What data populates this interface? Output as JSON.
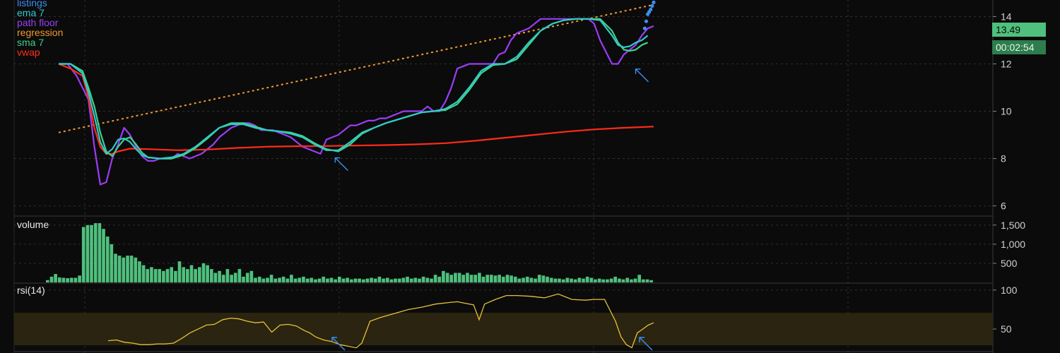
{
  "legend": [
    {
      "label": "listings",
      "color": "#3d8ef0"
    },
    {
      "label": "ema 7",
      "color": "#33c9c9"
    },
    {
      "label": "path floor",
      "color": "#9b3df5"
    },
    {
      "label": "regression",
      "color": "#f29a2e"
    },
    {
      "label": "sma 7",
      "color": "#3fd18a"
    },
    {
      "label": "vwap",
      "color": "#ff2b1a"
    }
  ],
  "price_badge": "13.49",
  "timer_badge": "00:02:54",
  "panes": {
    "volume_label": "volume",
    "rsi_label": "rsi(14)"
  },
  "colors": {
    "background": "#0b0b0b",
    "grid": "#2e2e2e",
    "axis_text": "#d0d0d0",
    "volume": "#4fc07d",
    "rsi": "#e5c23a",
    "rsi_band": "#2a2410",
    "arrow": "#3d8ef0"
  },
  "chart_data": [
    {
      "type": "line",
      "pane": "price",
      "yticks": [
        6,
        8,
        10,
        12,
        14
      ],
      "ylim": [
        5.6,
        14.7
      ],
      "xlim": [
        0,
        200
      ],
      "series": [
        {
          "name": "path floor",
          "color": "#9b3df5",
          "x": [
            0,
            3,
            6,
            8,
            10,
            12,
            14,
            16,
            18,
            20,
            22,
            24,
            26,
            28,
            30,
            32,
            34,
            36,
            38,
            40,
            44,
            48,
            52,
            54,
            56,
            58,
            60,
            62,
            64,
            66,
            68,
            70,
            72,
            74,
            76,
            78,
            80,
            82,
            84,
            86,
            88,
            90,
            92,
            94,
            96,
            98,
            100,
            102,
            104,
            106,
            108,
            110,
            112,
            114,
            116,
            118,
            120,
            122,
            124,
            126,
            128,
            130,
            132,
            134,
            136,
            138,
            140,
            142,
            144,
            146,
            148,
            150,
            152,
            154,
            156,
            158,
            160,
            162,
            164,
            166,
            168,
            170,
            172,
            174,
            176,
            178,
            180,
            182,
            184,
            186,
            188,
            190,
            192,
            194,
            196,
            198,
            200
          ],
          "y": [
            12,
            12,
            11.5,
            11,
            10.5,
            8.5,
            6.9,
            7,
            8,
            8.6,
            9.3,
            9,
            8.5,
            8.1,
            7.9,
            7.9,
            8,
            8,
            8,
            8.2,
            8,
            8.2,
            8.6,
            8.9,
            9.1,
            9.3,
            9.4,
            9.5,
            9.5,
            9.4,
            9.2,
            9.2,
            9.2,
            9.1,
            9,
            8.9,
            8.7,
            8.5,
            8.4,
            8.3,
            8.2,
            8.8,
            8.9,
            9,
            9.2,
            9.4,
            9.4,
            9.5,
            9.6,
            9.6,
            9.7,
            9.7,
            9.8,
            9.9,
            10,
            10,
            10,
            10,
            10.2,
            10,
            10,
            10.4,
            11,
            11.8,
            11.9,
            12,
            12,
            12,
            12,
            12,
            12.4,
            12.5,
            13,
            13.3,
            13.4,
            13.5,
            13.7,
            13.9,
            13.9,
            13.9,
            13.9,
            13.9,
            13.9,
            13.9,
            13.9,
            13.9,
            13.7,
            13,
            12.5,
            12,
            12,
            12.4,
            12.6,
            12.8,
            13.2,
            13.5,
            13.6
          ]
        },
        {
          "name": "ema 7",
          "color": "#33c9c9",
          "x": [
            0,
            4,
            8,
            10,
            12,
            14,
            16,
            18,
            20,
            22,
            24,
            26,
            28,
            30,
            34,
            38,
            42,
            46,
            50,
            54,
            58,
            62,
            66,
            70,
            74,
            78,
            82,
            86,
            90,
            94,
            98,
            102,
            106,
            110,
            114,
            118,
            122,
            126,
            130,
            134,
            138,
            142,
            146,
            150,
            154,
            158,
            162,
            166,
            170,
            174,
            178,
            182,
            186,
            188,
            190,
            192,
            194,
            196,
            198
          ],
          "y": [
            12,
            12,
            11.6,
            10.8,
            9.8,
            8.7,
            8.2,
            8.4,
            8.8,
            8.85,
            8.7,
            8.4,
            8.15,
            8.05,
            8,
            8.05,
            8.2,
            8.5,
            8.9,
            9.3,
            9.45,
            9.45,
            9.3,
            9.2,
            9.15,
            9.05,
            8.9,
            8.6,
            8.35,
            8.35,
            8.7,
            9.1,
            9.3,
            9.5,
            9.65,
            9.8,
            9.95,
            10,
            10.1,
            10.4,
            11,
            11.7,
            12,
            12,
            12.3,
            12.9,
            13.4,
            13.7,
            13.85,
            13.9,
            13.9,
            13.85,
            13.2,
            12.8,
            12.7,
            12.75,
            12.9,
            13,
            13.2
          ]
        },
        {
          "name": "sma 7",
          "color": "#3fd18a",
          "x": [
            0,
            4,
            8,
            10,
            12,
            14,
            16,
            18,
            20,
            22,
            24,
            26,
            28,
            30,
            34,
            38,
            42,
            46,
            50,
            54,
            58,
            62,
            66,
            70,
            74,
            78,
            82,
            86,
            90,
            94,
            98,
            102,
            106,
            110,
            114,
            118,
            122,
            126,
            130,
            134,
            138,
            142,
            146,
            150,
            154,
            158,
            162,
            166,
            170,
            174,
            178,
            182,
            186,
            188,
            190,
            192,
            194,
            196,
            198
          ],
          "y": [
            12,
            12,
            11.7,
            11,
            10.2,
            9.1,
            8.3,
            8.1,
            8.5,
            8.8,
            8.9,
            8.6,
            8.25,
            8.05,
            8,
            8,
            8.15,
            8.45,
            8.85,
            9.3,
            9.5,
            9.5,
            9.35,
            9.2,
            9.15,
            9.1,
            8.95,
            8.65,
            8.4,
            8.3,
            8.6,
            9.05,
            9.3,
            9.5,
            9.65,
            9.8,
            9.95,
            10,
            10.05,
            10.3,
            10.9,
            11.6,
            11.95,
            12,
            12.2,
            12.8,
            13.4,
            13.7,
            13.85,
            13.9,
            13.9,
            13.9,
            13.4,
            12.9,
            12.6,
            12.55,
            12.6,
            12.8,
            12.9
          ]
        },
        {
          "name": "vwap",
          "color": "#ff2b1a",
          "x": [
            0,
            4,
            8,
            10,
            12,
            14,
            16,
            18,
            20,
            24,
            30,
            40,
            50,
            60,
            70,
            80,
            90,
            100,
            110,
            120,
            130,
            140,
            150,
            160,
            170,
            180,
            190,
            200
          ],
          "y": [
            12,
            11.8,
            11.5,
            10.6,
            9.3,
            8.5,
            8.2,
            8.2,
            8.3,
            8.42,
            8.4,
            8.35,
            8.38,
            8.45,
            8.5,
            8.52,
            8.53,
            8.55,
            8.57,
            8.6,
            8.65,
            8.75,
            8.88,
            9,
            9.13,
            9.23,
            9.3,
            9.35
          ]
        },
        {
          "name": "regression",
          "color": "#f29a2e",
          "dashed": true,
          "x": [
            0,
            200
          ],
          "y": [
            9.1,
            14.5
          ]
        },
        {
          "name": "listings",
          "color": "#3d8ef0",
          "type": "scatter",
          "x": [
            197,
            197.5,
            198,
            198.5,
            199,
            199.5,
            200,
            200.5
          ],
          "y": [
            13.5,
            13.8,
            14.1,
            14.2,
            14.3,
            14.45,
            14.6,
            15.0
          ]
        }
      ],
      "markers": [
        {
          "x": 92,
          "y": 8.15
        },
        {
          "x": 193,
          "y": 11.9
        }
      ]
    },
    {
      "type": "bar",
      "pane": "volume",
      "yticks": [
        500,
        1000,
        1500
      ],
      "yticklabels": [
        "500",
        "1,000",
        "1,500"
      ],
      "ylim": [
        0,
        1700
      ],
      "values": [
        60,
        150,
        220,
        130,
        120,
        110,
        120,
        120,
        180,
        1450,
        1500,
        1500,
        1550,
        1550,
        1400,
        1200,
        1000,
        750,
        700,
        650,
        700,
        700,
        650,
        550,
        450,
        350,
        400,
        350,
        350,
        300,
        350,
        400,
        300,
        550,
        400,
        350,
        450,
        350,
        400,
        500,
        450,
        350,
        250,
        300,
        200,
        350,
        200,
        250,
        350,
        150,
        250,
        300,
        120,
        150,
        100,
        120,
        200,
        100,
        120,
        150,
        100,
        200,
        100,
        120,
        150,
        100,
        120,
        80,
        100,
        150,
        100,
        120,
        80,
        150,
        100,
        120,
        80,
        100,
        100,
        80,
        100,
        120,
        100,
        150,
        100,
        120,
        80,
        100,
        100,
        120,
        150,
        100,
        120,
        100,
        150,
        120,
        100,
        200,
        150,
        300,
        250,
        200,
        250,
        250,
        200,
        250,
        200,
        200,
        250,
        150,
        200,
        200,
        180,
        200,
        150,
        200,
        180,
        150,
        100,
        120,
        150,
        120,
        100,
        200,
        180,
        150,
        120,
        100,
        100,
        80,
        120,
        100,
        80,
        120,
        100,
        150,
        120,
        80,
        100,
        80,
        80,
        100,
        150,
        100,
        80,
        120,
        80,
        100,
        200,
        80,
        80,
        60
      ]
    },
    {
      "type": "line",
      "pane": "rsi",
      "name": "rsi(14)",
      "yticks": [
        50,
        100
      ],
      "ylim": [
        22,
        108
      ],
      "band": [
        30,
        70
      ],
      "x": [
        0,
        3,
        6,
        9,
        12,
        15,
        18,
        21,
        24,
        27,
        30,
        33,
        36,
        39,
        42,
        45,
        48,
        51,
        54,
        57,
        60,
        63,
        66,
        69,
        72,
        74,
        76,
        79,
        82,
        85,
        88,
        91,
        93,
        96,
        100,
        105,
        110,
        115,
        120,
        125,
        128,
        131,
        134,
        136,
        138,
        142,
        146,
        150,
        155,
        160,
        165,
        170,
        175,
        178,
        182,
        186,
        188,
        190,
        192,
        194,
        196,
        198,
        200
      ],
      "y": [
        35,
        36,
        33,
        32,
        30,
        30,
        31,
        31,
        32,
        38,
        45,
        50,
        55,
        56,
        62,
        64,
        63,
        60,
        58,
        59,
        46,
        55,
        56,
        54,
        48,
        45,
        40,
        36,
        34,
        30,
        28,
        26,
        32,
        60,
        65,
        70,
        75,
        78,
        82,
        84,
        85,
        83,
        81,
        62,
        82,
        88,
        93,
        93,
        92,
        90,
        95,
        88,
        87,
        88,
        88,
        60,
        40,
        30,
        26,
        45,
        50,
        55,
        58
      ]
    }
  ]
}
